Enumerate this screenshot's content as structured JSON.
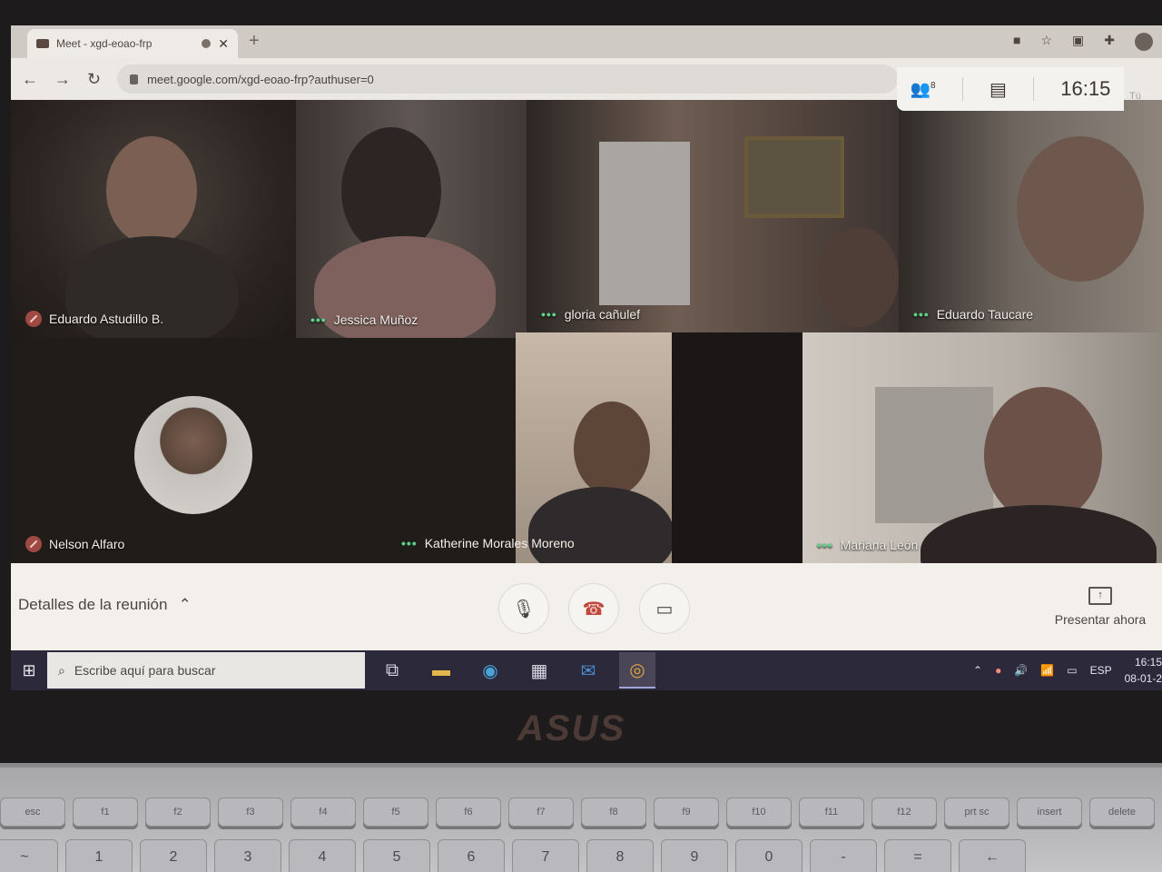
{
  "browser": {
    "tab_title": "Meet - xgd-eoao-frp",
    "new_tab_symbol": "+",
    "url": "meet.google.com/xgd-eoao-frp?authuser=0"
  },
  "meet": {
    "participant_count": "8",
    "clock": "16:15",
    "self_label": "Tú",
    "participants": [
      {
        "name": "Eduardo Astudillo B.",
        "status": "muted"
      },
      {
        "name": "Jessica Muñoz",
        "status": "speaking"
      },
      {
        "name": "gloria cañulef",
        "status": "speaking"
      },
      {
        "name": "Eduardo Taucare",
        "status": "speaking"
      },
      {
        "name": "Nelson Alfaro",
        "status": "muted"
      },
      {
        "name": "Katherine Morales Moreno",
        "status": "speaking"
      },
      {
        "name": "Mariana León",
        "status": "speaking"
      }
    ],
    "details_label": "Detalles de la reunión",
    "present_label": "Presentar ahora"
  },
  "taskbar": {
    "search_placeholder": "Escribe aquí para buscar",
    "language": "ESP",
    "time": "16:15",
    "date": "08-01-2"
  },
  "laptop": {
    "brand": "ASUS",
    "fn_keys": [
      "esc",
      "f1",
      "f2",
      "f3",
      "f4",
      "f5",
      "f6",
      "f7",
      "f8",
      "f9",
      "f10",
      "f11",
      "f12",
      "prt sc",
      "insert",
      "delete"
    ],
    "num_keys": [
      "~",
      "1",
      "2",
      "3",
      "4",
      "5",
      "6",
      "7",
      "8",
      "9",
      "0",
      "-",
      "=",
      "←"
    ]
  }
}
